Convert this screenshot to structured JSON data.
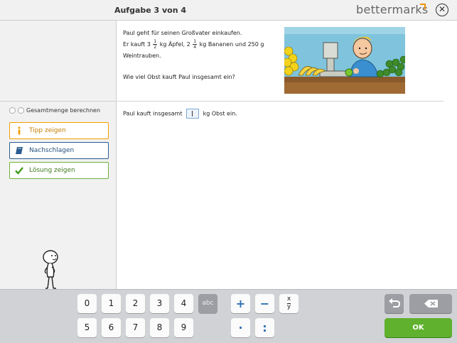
{
  "header": {
    "task_title": "Aufgabe 3 von 4",
    "brand": "bettermarks",
    "close_label": "✕"
  },
  "sidebar": {
    "step_label": "Gesamtmenge berechnen",
    "buttons": [
      {
        "label": "Tipp zeigen",
        "icon": "info-icon",
        "color": "#f2a000"
      },
      {
        "label": "Nachschlagen",
        "icon": "book-icon",
        "color": "#2a5c8e"
      },
      {
        "label": "Lösung zeigen",
        "icon": "check-icon",
        "color": "#6fb23a"
      }
    ]
  },
  "problem": {
    "line1": "Paul geht für seinen Großvater einkaufen.",
    "line2_a": "Er kauft 3",
    "frac1": {
      "num": "1",
      "den": "2"
    },
    "line2_b": "kg Äpfel, 2",
    "frac2": {
      "num": "1",
      "den": "4"
    },
    "line2_c": "kg Bananen und 250 g",
    "line3": "Weintrauben.",
    "question": "Wie viel Obst kauft Paul insgesamt ein?"
  },
  "answer": {
    "prefix": "Paul kauft insgesamt",
    "suffix": "kg Obst ein."
  },
  "keyboard": {
    "row1": [
      "0",
      "1",
      "2",
      "3",
      "4"
    ],
    "row2": [
      "5",
      "6",
      "7",
      "8",
      "9"
    ],
    "abc": "abc",
    "plus": "+",
    "minus": "−",
    "dot": "·",
    "colon": ":",
    "fraction_num": "x",
    "fraction_den": "y",
    "ok": "OK"
  },
  "colors": {
    "ok_green": "#5fb12e",
    "operator_blue": "#2c6fb3",
    "brand_orange": "#f29400"
  }
}
